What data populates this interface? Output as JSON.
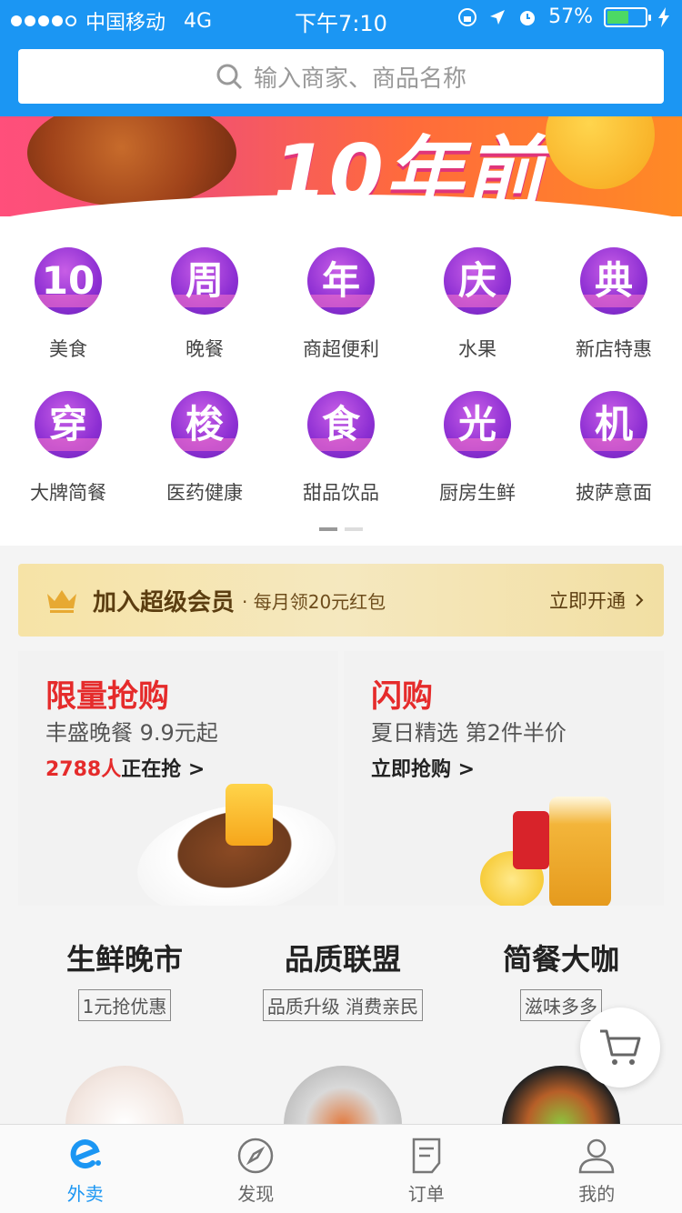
{
  "status_bar": {
    "carrier": "中国移动",
    "network": "4G",
    "time": "下午7:10",
    "battery": "57%",
    "battery_level": 0.57
  },
  "search": {
    "placeholder": "输入商家、商品名称"
  },
  "banner": {
    "title": "10年前"
  },
  "categories": [
    {
      "glyph": "10",
      "label": "美食"
    },
    {
      "glyph": "周",
      "label": "晚餐"
    },
    {
      "glyph": "年",
      "label": "商超便利"
    },
    {
      "glyph": "庆",
      "label": "水果"
    },
    {
      "glyph": "典",
      "label": "新店特惠"
    },
    {
      "glyph": "穿",
      "label": "大牌简餐"
    },
    {
      "glyph": "梭",
      "label": "医药健康"
    },
    {
      "glyph": "食",
      "label": "甜品饮品"
    },
    {
      "glyph": "光",
      "label": "厨房生鲜"
    },
    {
      "glyph": "机",
      "label": "披萨意面"
    }
  ],
  "vip": {
    "title": "加入超级会员",
    "subtitle": "· 每月领20元红包",
    "cta": "立即开通"
  },
  "promos": [
    {
      "title": "限量抢购",
      "subtitle": "丰盛晚餐 9.9元起",
      "count": "2788人",
      "cta": "正在抢 >"
    },
    {
      "title": "闪购",
      "subtitle": "夏日精选 第2件半价",
      "cta": "立即抢购 >"
    }
  ],
  "small_cards": [
    {
      "title": "生鲜晚市",
      "tag": "1元抢优惠"
    },
    {
      "title": "品质联盟",
      "tag": "品质升级 消费亲民"
    },
    {
      "title": "简餐大咖",
      "tag": "滋味多多"
    }
  ],
  "tabs": [
    {
      "label": "外卖",
      "icon": "eleme-icon"
    },
    {
      "label": "发现",
      "icon": "compass-icon"
    },
    {
      "label": "订单",
      "icon": "order-icon"
    },
    {
      "label": "我的",
      "icon": "user-icon"
    }
  ],
  "colors": {
    "brand": "#1b96f3",
    "promo_red": "#e52b2b",
    "icon_purple": "#8d2fd3",
    "vip_gold": "#f5e8bf"
  }
}
